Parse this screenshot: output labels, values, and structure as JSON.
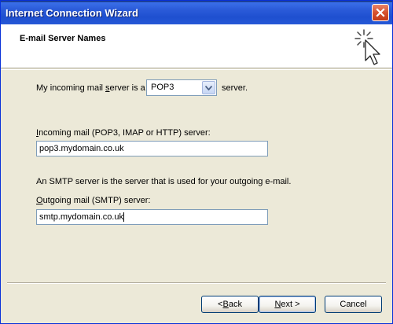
{
  "window": {
    "title": "Internet Connection Wizard"
  },
  "header": {
    "title": "E-mail Server Names"
  },
  "incoming_type": {
    "prefix": "My incoming mail ",
    "prefix_u": "s",
    "prefix_rest": "erver is a",
    "value": "POP3",
    "suffix": "server."
  },
  "incoming_server": {
    "label_u": "I",
    "label_rest": "ncoming mail (POP3, IMAP or HTTP) server:",
    "value": "pop3.mydomain.co.uk"
  },
  "smtp_info": "An SMTP server is the server that is used for your outgoing e-mail.",
  "outgoing_server": {
    "label_u": "O",
    "label_rest": "utgoing mail (SMTP) server:",
    "value": "smtp.mydomain.co.uk"
  },
  "buttons": {
    "back_prefix": "< ",
    "back_u": "B",
    "back_rest": "ack",
    "next_u": "N",
    "next_rest": "ext >",
    "cancel": "Cancel"
  },
  "colors": {
    "titlebar": "#2a5ad8",
    "dialog_bg": "#ece9d8",
    "close": "#d6522e"
  },
  "icons": [
    "close-icon",
    "wizard-cursor-icon",
    "dropdown-arrow-icon"
  ]
}
